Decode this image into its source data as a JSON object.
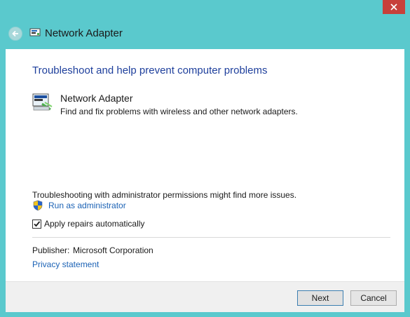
{
  "window": {
    "title": "Network Adapter"
  },
  "main": {
    "heading": "Troubleshoot and help prevent computer problems",
    "item": {
      "title": "Network Adapter",
      "description": "Find and fix problems with wireless and other network adapters."
    },
    "admin_info": "Troubleshooting with administrator permissions might find more issues.",
    "run_as_admin_label": "Run as administrator",
    "apply_repairs": {
      "label": "Apply repairs automatically",
      "checked": true
    },
    "publisher_label": "Publisher:",
    "publisher_value": "Microsoft Corporation",
    "privacy_link": "Privacy statement"
  },
  "footer": {
    "next_label": "Next",
    "cancel_label": "Cancel"
  },
  "icons": {
    "close": "close-icon",
    "back": "back-arrow-icon",
    "title": "network-adapter-icon",
    "item": "network-adapter-icon",
    "shield": "uac-shield-icon",
    "check": "checkmark-icon"
  },
  "colors": {
    "frame": "#5ac9cd",
    "close_button": "#c7403a",
    "heading": "#1e3f9c",
    "link": "#1b62b5",
    "footer": "#f0f0f0"
  }
}
